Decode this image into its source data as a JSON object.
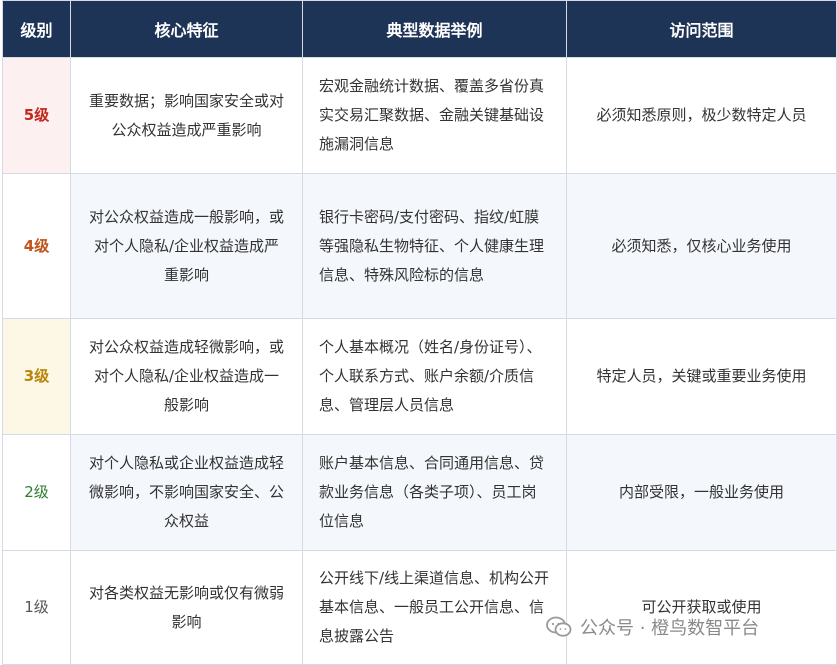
{
  "headers": [
    "级别",
    "核心特征",
    "典型数据举例",
    "访问范围"
  ],
  "rows": [
    {
      "level": "5级",
      "feature": "重要数据；影响国家安全或对公众权益造成严重影响",
      "examples": "宏观金融统计数据、覆盖多省份真实交易汇聚数据、金融关键基础设施漏洞信息",
      "access": "必须知悉原则，极少数特定人员"
    },
    {
      "level": "4级",
      "feature": "对公众权益造成一般影响，或对个人隐私/企业权益造成严重影响",
      "examples": "银行卡密码/支付密码、指纹/虹膜等强隐私生物特征、个人健康生理信息、特殊风险标的信息",
      "access": "必须知悉，仅核心业务使用"
    },
    {
      "level": "3级",
      "feature": "对公众权益造成轻微影响，或对个人隐私/企业权益造成一般影响",
      "examples": "个人基本概况（姓名/身份证号）、个人联系方式、账户余额/介质信息、管理层人员信息",
      "access": "特定人员，关键或重要业务使用"
    },
    {
      "level": "2级",
      "feature": "对个人隐私或企业权益造成轻微影响，不影响国家安全、公众权益",
      "examples": "账户基本信息、合同通用信息、贷款业务信息（各类子项）、员工岗位信息",
      "access": "内部受限，一般业务使用"
    },
    {
      "level": "1级",
      "feature": "对各类权益无影响或仅有微弱影响",
      "examples": "公开线下/线上渠道信息、机构公开基本信息、一般员工公开信息、信息披露公告",
      "access": "可公开获取或使用"
    }
  ],
  "watermark": {
    "text": "公众号 · 橙鸟数智平台",
    "icon": "wechat-icon"
  },
  "colors": {
    "header_bg": "#1e3456",
    "level5": "#c0281e",
    "level4": "#c0541c",
    "level3": "#b8860b",
    "level2": "#2e7d32",
    "level1": "#555555"
  }
}
